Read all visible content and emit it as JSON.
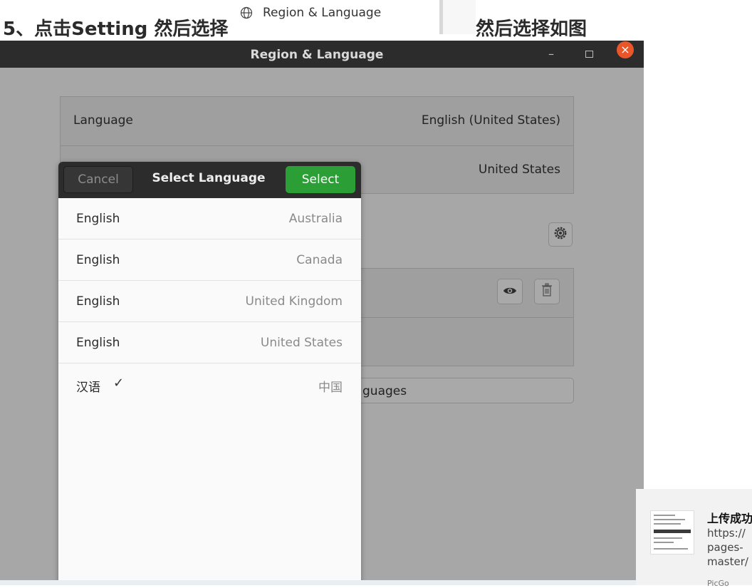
{
  "banner": {
    "step_text": "5、点击Setting 然后选择",
    "inline_item_label": "Region & Language",
    "suffix_text": "然后选择如图"
  },
  "window": {
    "title": "Region & Language",
    "minimize_glyph": "–",
    "close_glyph": "×"
  },
  "settings": {
    "language_label": "Language",
    "language_value": "English (United States)",
    "formats_value": "United States",
    "manage_label_partial": "guages"
  },
  "dialog": {
    "cancel_label": "Cancel",
    "title": "Select Language",
    "select_label": "Select",
    "languages": [
      {
        "name": "English",
        "region": "Australia",
        "checked": false
      },
      {
        "name": "English",
        "region": "Canada",
        "checked": false
      },
      {
        "name": "English",
        "region": "United Kingdom",
        "checked": false
      },
      {
        "name": "English",
        "region": "United States",
        "checked": false
      },
      {
        "name": "汉语",
        "region": "中国",
        "checked": true
      }
    ],
    "check_glyph": "✓"
  },
  "notification": {
    "title": "上传成功",
    "lines": [
      "https://",
      "pages-",
      "master/"
    ],
    "footer": "PicGo"
  },
  "icons": {
    "globe": "globe-icon",
    "gear": "gear-icon",
    "eye": "eye-icon",
    "trash": "trash-icon"
  },
  "colors": {
    "select_button": "#2b9f35",
    "close_button": "#e8562a",
    "titlebar": "#2c2c2c",
    "window_dimmed": "#a7a7a7"
  }
}
